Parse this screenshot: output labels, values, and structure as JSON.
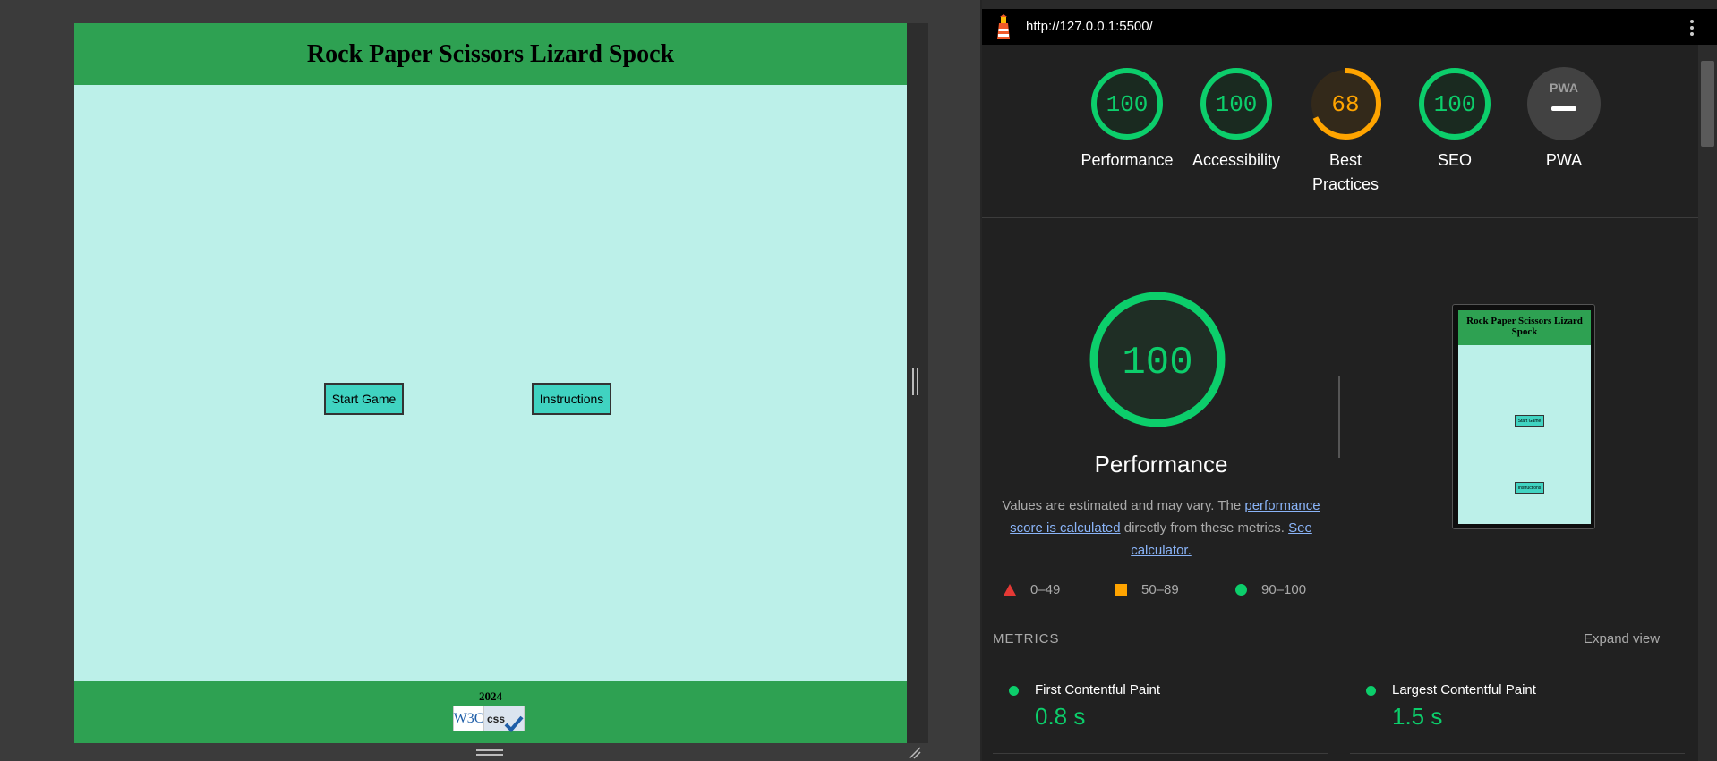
{
  "site": {
    "title": "Rock Paper Scissors Lizard Spock",
    "start_button": "Start Game",
    "instructions_button": "Instructions",
    "footer_year": "2024",
    "badge_w3c": "W3C",
    "badge_css": "css",
    "header_color": "#2ea152",
    "main_bg_color": "#bcf0e9",
    "button_color": "#40d3c1"
  },
  "lighthouse": {
    "url": "http://127.0.0.1:5500/",
    "gauges": [
      {
        "label": "Performance",
        "score": "100",
        "status": "pass"
      },
      {
        "label": "Accessibility",
        "score": "100",
        "status": "pass"
      },
      {
        "label": "Best Practices",
        "score": "68",
        "status": "average"
      },
      {
        "label": "SEO",
        "score": "100",
        "status": "pass"
      },
      {
        "label": "PWA",
        "score": "",
        "status": "na"
      }
    ],
    "pwa_icon_text": "PWA",
    "big_gauge": {
      "score": "100",
      "title": "Performance"
    },
    "description": {
      "text1": "Values are estimated and may vary. The ",
      "link1": "performance score is calculated",
      "text2": " directly from these metrics. ",
      "link2": "See calculator."
    },
    "legend": [
      {
        "range": "0–49",
        "color": "#e53935",
        "shape": "triangle"
      },
      {
        "range": "50–89",
        "color": "#ffa400",
        "shape": "square"
      },
      {
        "range": "90–100",
        "color": "#0cce6b",
        "shape": "circle"
      }
    ],
    "thumbnail": {
      "title": "Rock Paper Scissors Lizard Spock",
      "start_button": "Start Game",
      "instructions_button": "Instructions"
    },
    "metrics_title": "METRICS",
    "expand_view": "Expand view",
    "metrics": [
      {
        "name": "First Contentful Paint",
        "value": "0.8 s"
      },
      {
        "name": "Largest Contentful Paint",
        "value": "1.5 s"
      }
    ],
    "colors": {
      "pass": "#0cce6b",
      "average": "#ffa400",
      "fail": "#e53935"
    }
  }
}
